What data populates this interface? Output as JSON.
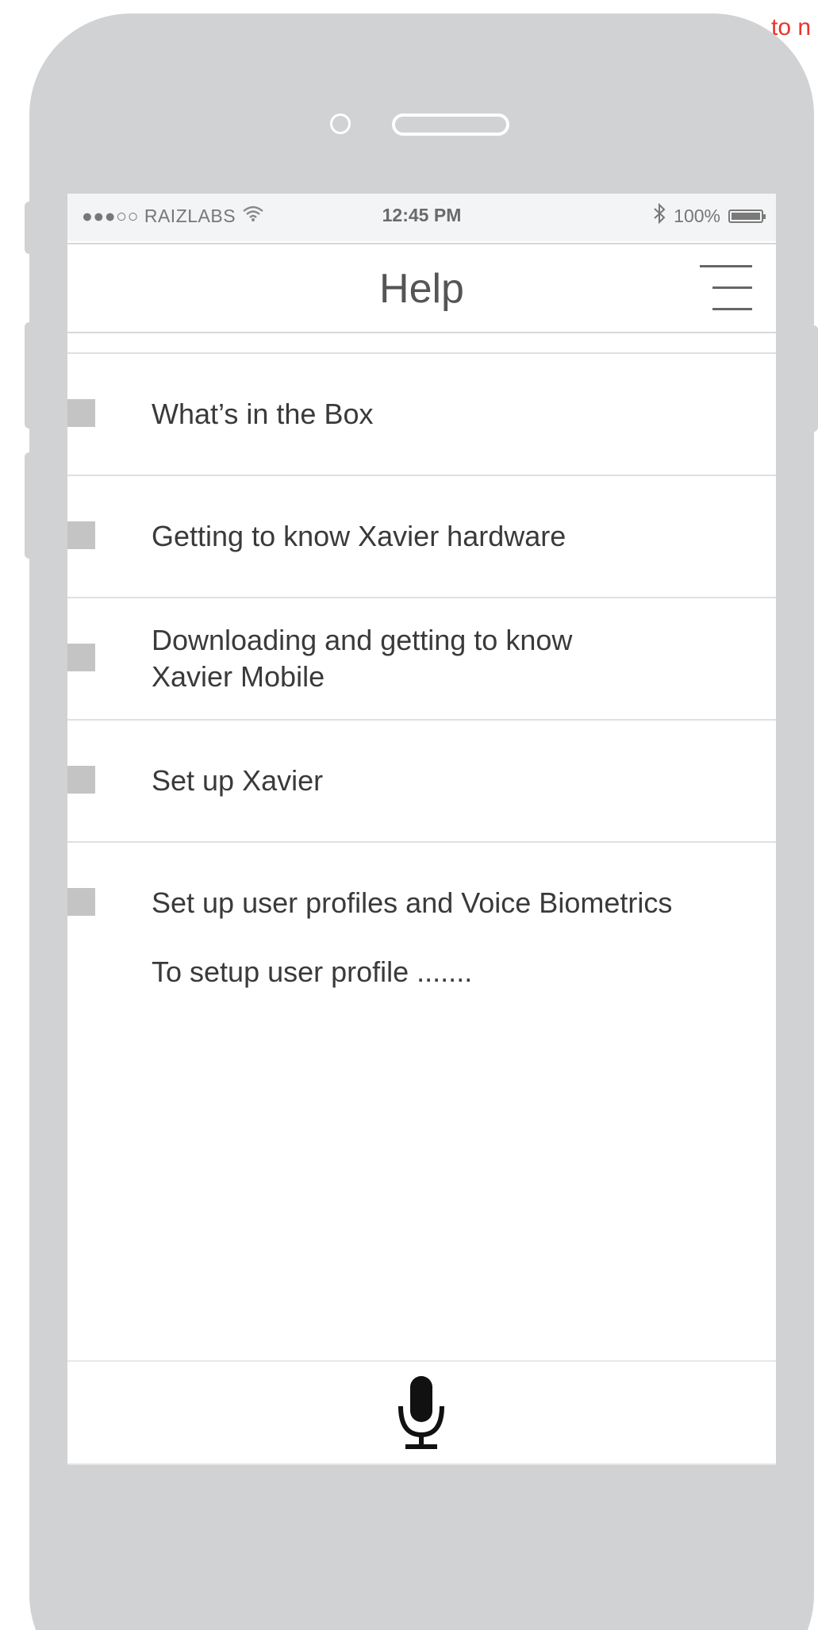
{
  "annotation": {
    "corner_note": "to n"
  },
  "status_bar": {
    "carrier": "●●●○○ RAIZLABS",
    "time": "12:45 PM",
    "battery": "100%",
    "battery_level": 1.0
  },
  "nav": {
    "title": "Help",
    "menu_icon": "hamburger-menu-icon"
  },
  "help_items": [
    {
      "label": "What’s in the Box"
    },
    {
      "label": "Getting to know Xavier hardware"
    },
    {
      "label": "Downloading and getting to know Xavier Mobile"
    },
    {
      "label": "Set up Xavier"
    },
    {
      "label": "Set up user profiles and Voice Biometrics"
    }
  ],
  "expanded_detail": "To setup user profile .......",
  "bottom_bar": {
    "mic_icon": "microphone-icon"
  },
  "colors": {
    "phone_body": "#d1d2d4",
    "annotation_red": "#e8342e",
    "bullet_gray": "#c4c4c4"
  }
}
